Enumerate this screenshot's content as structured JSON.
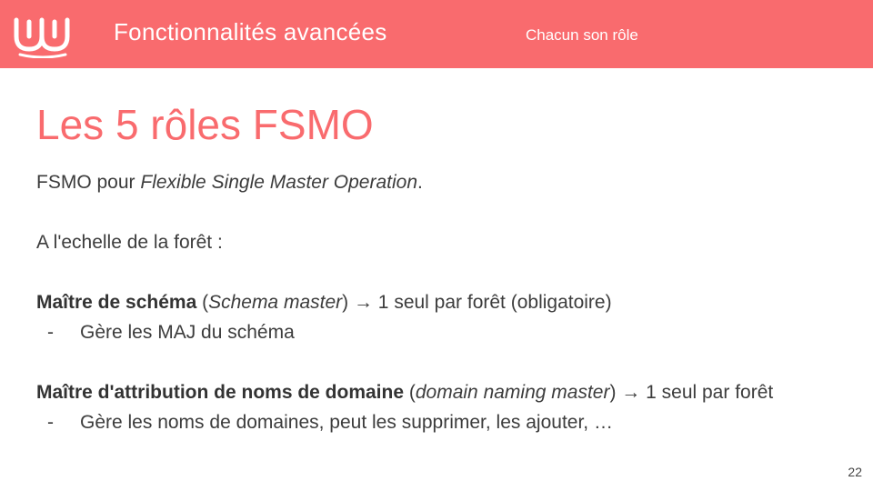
{
  "header": {
    "title": "Fonctionnalités avancées",
    "subtitle": "Chacun son rôle",
    "brand_color": "#f96b6e"
  },
  "slide": {
    "title": "Les 5 rôles FSMO",
    "intro": {
      "prefix": "FSMO pour ",
      "emphasis": "Flexible Single Master Operation",
      "suffix": "."
    },
    "scope": "A l'echelle de la forêt :",
    "roles": [
      {
        "name": "Maître de schéma",
        "open_paren": " (",
        "english": "Schema master",
        "rest": ") → 1 seul par forêt (obligatoire)",
        "bullet_dash": "-",
        "bullet": "Gère les MAJ du schéma"
      },
      {
        "name": "Maître d'attribution de noms de domaine",
        "open_paren": " (",
        "english": "domain naming master",
        "rest": ") → 1 seul par forêt",
        "bullet_dash": "-",
        "bullet": "Gère les noms de domaines, peut les supprimer, les ajouter, …"
      }
    ],
    "page_number": "22"
  }
}
